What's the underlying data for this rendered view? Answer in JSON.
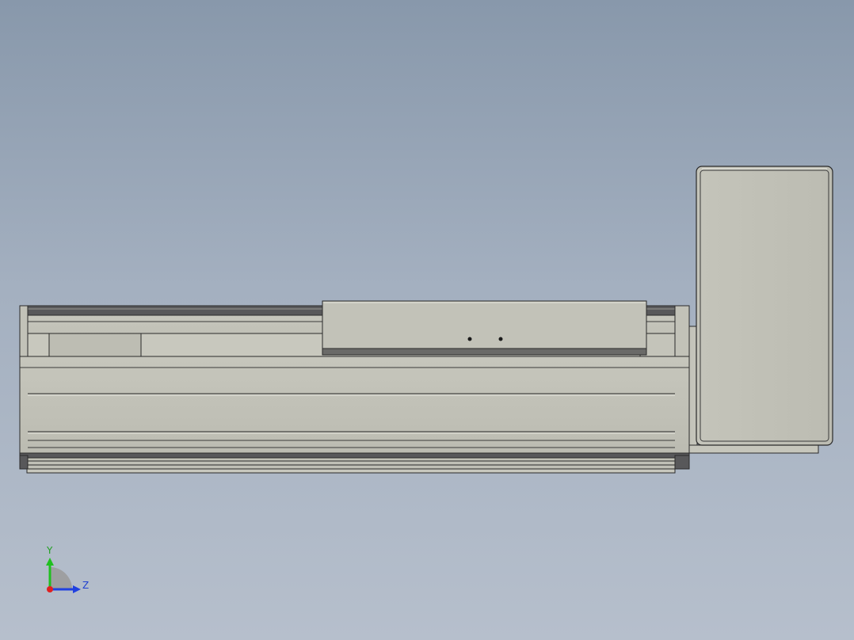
{
  "viewport": {
    "background_top": "#8898ab",
    "background_bottom": "#b6bfcc"
  },
  "model": {
    "body_color": "#c0c0b6",
    "edge_color": "#2a2a2a",
    "dark_rail_color": "#58585a",
    "highlight_color": "#e4e4dc"
  },
  "triad": {
    "y_label": "Y",
    "z_label": "Z",
    "y_color": "#20c020",
    "z_color": "#2040e0",
    "x_color": "#e02020"
  }
}
